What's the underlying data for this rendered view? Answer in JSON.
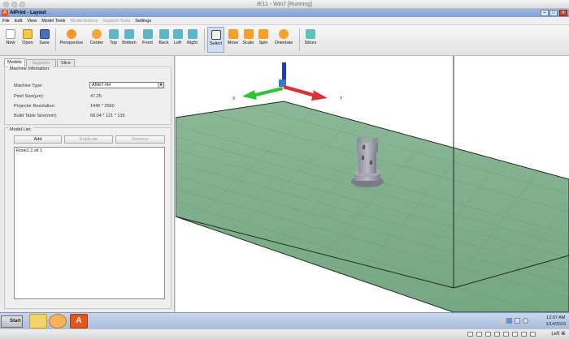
{
  "host": {
    "title": "IE11 - Win7 [Running]",
    "host_key": "Left ⌘"
  },
  "app": {
    "title": "AIPrint - Layout",
    "logo_letter": "A"
  },
  "menu": [
    {
      "label": "File",
      "enabled": true
    },
    {
      "label": "Edit",
      "enabled": true
    },
    {
      "label": "View",
      "enabled": true
    },
    {
      "label": "Model Tools",
      "enabled": true
    },
    {
      "label": "Model Actions",
      "enabled": false
    },
    {
      "label": "Support Tools",
      "enabled": false
    },
    {
      "label": "Settings",
      "enabled": true
    }
  ],
  "toolbar": {
    "new": "New",
    "open": "Open",
    "save": "Save",
    "perspective": "Perspective",
    "center": "Center",
    "top": "Top",
    "bottom": "Bottom",
    "front": "Front",
    "back": "Back",
    "left": "Left",
    "right": "Right",
    "select": "Select",
    "move": "Move",
    "scale": "Scale",
    "spin": "Spin",
    "orientate": "Orientate",
    "slices": "Slices",
    "active_tool": "Select"
  },
  "left_panel": {
    "tabs": [
      {
        "label": "Models",
        "active": true,
        "enabled": true
      },
      {
        "label": "Supports",
        "active": false,
        "enabled": false
      },
      {
        "label": "Slice",
        "active": false,
        "enabled": true
      }
    ],
    "machine_info": {
      "group_label": "Machine Infomation:",
      "machine_type_label": "Machine Type:",
      "machine_type_value": "ANET-N4",
      "pixel_size_label": "Pixel Size(μm):",
      "pixel_size_value": "47.25",
      "projector_res_label": "Projector Resolution:",
      "projector_res_value": "1440 * 2560",
      "build_size_label": "Build Table Size(mm):",
      "build_size_value": "68.04 * 121 * 135"
    },
    "model_list": {
      "group_label": "Model List:",
      "add": "Add",
      "duplicate": "Duplicate",
      "remove": "Remove",
      "items": [
        "Rook1 2.stl 1"
      ]
    }
  },
  "viewport": {
    "axis_x": "X",
    "axis_y": "Y",
    "plate_color": "#7fae8c",
    "grid_color": "#5f8d6c"
  },
  "taskbar": {
    "start": "Start",
    "time": "12:07 AM",
    "date": "1/14/2019"
  },
  "colors": {
    "axis_x": "#2fc52f",
    "axis_y": "#d83434",
    "axis_z": "#1d36d8",
    "title_bar": "#8aa7dc",
    "app_icon": "#e5541a"
  }
}
